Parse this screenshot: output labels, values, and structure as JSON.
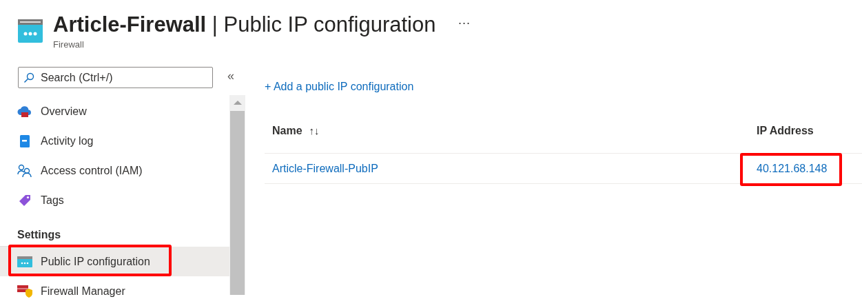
{
  "header": {
    "resource": "Article-Firewall",
    "separator": "|",
    "page": "Public IP configuration",
    "subtitle": "Firewall",
    "more": "···"
  },
  "sidebar": {
    "search": {
      "placeholder": "Search (Ctrl+/)"
    },
    "collapse": "«",
    "items": [
      {
        "kind": "item",
        "label": "Overview",
        "selected": false,
        "highlighted": false
      },
      {
        "kind": "item",
        "label": "Activity log",
        "selected": false,
        "highlighted": false
      },
      {
        "kind": "item",
        "label": "Access control (IAM)",
        "selected": false,
        "highlighted": false
      },
      {
        "kind": "item",
        "label": "Tags",
        "selected": false,
        "highlighted": false
      },
      {
        "kind": "heading",
        "label": "Settings"
      },
      {
        "kind": "item",
        "label": "Public IP configuration",
        "selected": true,
        "highlighted": true
      },
      {
        "kind": "item",
        "label": "Firewall Manager",
        "selected": false,
        "highlighted": false
      }
    ]
  },
  "toolbar": {
    "add": "+ Add a public IP configuration"
  },
  "table": {
    "columns": [
      {
        "label": "Name",
        "sort": "↑↓"
      },
      {
        "label": "IP Address"
      }
    ],
    "rows": [
      {
        "name": "Article-Firewall-PubIP",
        "ip": "40.121.68.148",
        "highlighted": true
      }
    ]
  }
}
